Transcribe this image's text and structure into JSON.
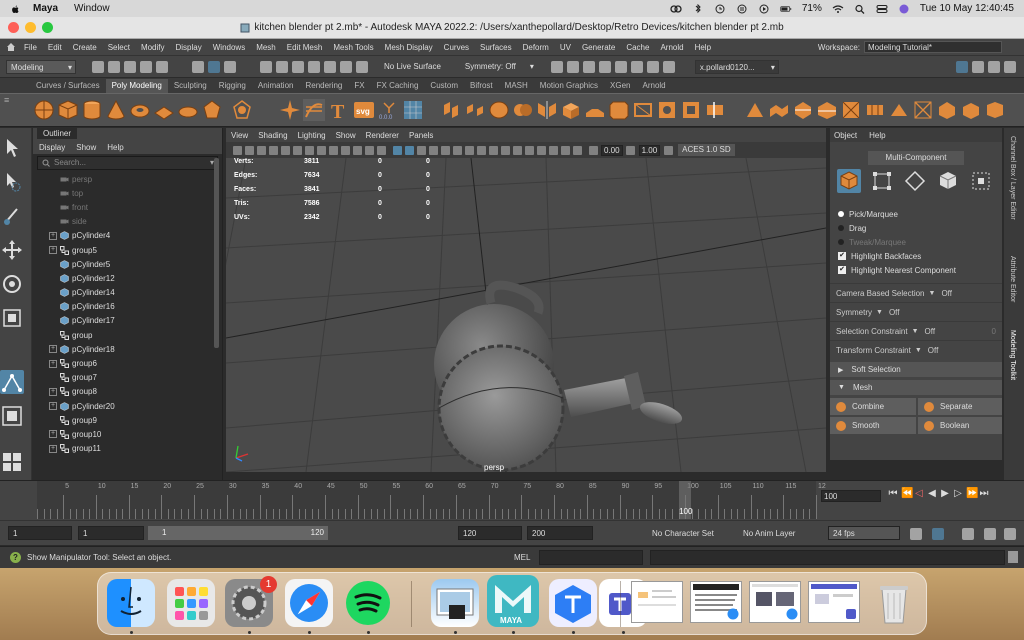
{
  "macos": {
    "app_name": "Maya",
    "menus": [
      "Window"
    ],
    "battery": "71%",
    "datetime": "Tue 10 May  12:40:45"
  },
  "window": {
    "title": "kitchen blender pt 2.mb* - Autodesk MAYA 2022.2: /Users/xanthepollard/Desktop/Retro Devices/kitchen blender pt 2.mb"
  },
  "maya_menu": {
    "items": [
      "File",
      "Edit",
      "Create",
      "Select",
      "Modify",
      "Display",
      "Windows",
      "Mesh",
      "Edit Mesh",
      "Mesh Tools",
      "Mesh Display",
      "Curves",
      "Surfaces",
      "Deform",
      "UV",
      "Generate",
      "Cache",
      "Arnold",
      "Help"
    ],
    "workspace_label": "Workspace:",
    "workspace_value": "Modeling Tutorial*"
  },
  "status_line": {
    "mode": "Modeling",
    "live_surface": "No Live Surface",
    "symmetry": "Symmetry: Off",
    "user": "x.pollard0120..."
  },
  "shelf": {
    "tabs": [
      "Curves / Surfaces",
      "Poly Modeling",
      "Sculpting",
      "Rigging",
      "Animation",
      "Rendering",
      "FX",
      "FX Caching",
      "Custom",
      "Bifrost",
      "MASH",
      "Motion Graphics",
      "XGen",
      "Arnold"
    ],
    "active_tab": 1,
    "text_icon_label": "T",
    "svg_icon_label": "svg",
    "zero_icon_label": "0.0.0"
  },
  "outliner": {
    "tab_label": "Outliner",
    "menu": [
      "Display",
      "Show",
      "Help"
    ],
    "search_placeholder": "Search...",
    "rows": [
      {
        "label": "persp",
        "type": "camera",
        "expandable": false
      },
      {
        "label": "top",
        "type": "camera",
        "expandable": false
      },
      {
        "label": "front",
        "type": "camera",
        "expandable": false
      },
      {
        "label": "side",
        "type": "camera",
        "expandable": false
      },
      {
        "label": "pCylinder4",
        "type": "mesh",
        "expandable": true
      },
      {
        "label": "group5",
        "type": "group",
        "expandable": true
      },
      {
        "label": "pCylinder5",
        "type": "mesh",
        "expandable": false
      },
      {
        "label": "pCylinder12",
        "type": "mesh",
        "expandable": false
      },
      {
        "label": "pCylinder14",
        "type": "mesh",
        "expandable": false
      },
      {
        "label": "pCylinder16",
        "type": "mesh",
        "expandable": false
      },
      {
        "label": "pCylinder17",
        "type": "mesh",
        "expandable": false
      },
      {
        "label": "group",
        "type": "group",
        "expandable": false
      },
      {
        "label": "pCylinder18",
        "type": "mesh",
        "expandable": true
      },
      {
        "label": "group6",
        "type": "group",
        "expandable": true
      },
      {
        "label": "group7",
        "type": "group",
        "expandable": false
      },
      {
        "label": "group8",
        "type": "group",
        "expandable": true
      },
      {
        "label": "pCylinder20",
        "type": "mesh",
        "expandable": true
      },
      {
        "label": "group9",
        "type": "group",
        "expandable": false
      },
      {
        "label": "group10",
        "type": "group",
        "expandable": true
      },
      {
        "label": "group11",
        "type": "group",
        "expandable": true
      }
    ]
  },
  "viewport": {
    "menu": [
      "View",
      "Shading",
      "Lighting",
      "Show",
      "Renderer",
      "Panels"
    ],
    "near_value": "0.00",
    "far_value": "1.00",
    "colorspace": "ACES 1.0 SD",
    "camera_label": "persp",
    "hud": [
      {
        "label": "Verts:",
        "value": "3811",
        "a": "0",
        "b": "0"
      },
      {
        "label": "Edges:",
        "value": "7634",
        "a": "0",
        "b": "0"
      },
      {
        "label": "Faces:",
        "value": "3841",
        "a": "0",
        "b": "0"
      },
      {
        "label": "Tris:",
        "value": "7586",
        "a": "0",
        "b": "0"
      },
      {
        "label": "UVs:",
        "value": "2342",
        "a": "0",
        "b": "0"
      }
    ]
  },
  "modeling_toolkit": {
    "menu": [
      "Object",
      "Help"
    ],
    "header": "Multi-Component",
    "radios": [
      {
        "label": "Pick/Marquee",
        "selected": true,
        "disabled": false
      },
      {
        "label": "Drag",
        "selected": false,
        "disabled": false
      },
      {
        "label": "Tweak/Marquee",
        "selected": false,
        "disabled": true
      }
    ],
    "checks": [
      {
        "label": "Highlight Backfaces",
        "checked": true
      },
      {
        "label": "Highlight Nearest Component",
        "checked": true
      }
    ],
    "props": [
      {
        "label": "Camera Based Selection",
        "value": "Off"
      },
      {
        "label": "Symmetry",
        "value": "Off"
      },
      {
        "label": "Selection Constraint",
        "value": "Off",
        "extra": "0"
      },
      {
        "label": "Transform Constraint",
        "value": "Off"
      }
    ],
    "soft_selection": "Soft Selection",
    "mesh_section": "Mesh",
    "mesh_buttons": [
      "Combine",
      "Separate",
      "Smooth",
      "Boolean"
    ],
    "side_tabs": [
      "Channel Box / Layer Editor",
      "Attribute Editor",
      "Modeling Toolkit"
    ]
  },
  "timeline": {
    "ticks": [
      5,
      10,
      15,
      20,
      25,
      30,
      35,
      40,
      45,
      50,
      55,
      60,
      65,
      70,
      75,
      80,
      85,
      90,
      95,
      100,
      105,
      110,
      115,
      12
    ],
    "current_frame": "100",
    "current_time_field": "100"
  },
  "range": {
    "start": "1",
    "playback_start": "1",
    "slider_start": "1",
    "slider_end": "120",
    "playback_end": "120",
    "end": "200",
    "character_set": "No Character Set",
    "anim_layer": "No Anim Layer",
    "fps": "24 fps"
  },
  "help_line": {
    "text": "Show Manipulator Tool: Select an object.",
    "mel_label": "MEL"
  },
  "dock": {
    "settings_badge": "1",
    "maya_label": "MAYA"
  },
  "colors": {
    "maya_orange": "#e08a3c",
    "highlight_blue": "#5285a6",
    "maya_teal": "#1ab3b3"
  }
}
